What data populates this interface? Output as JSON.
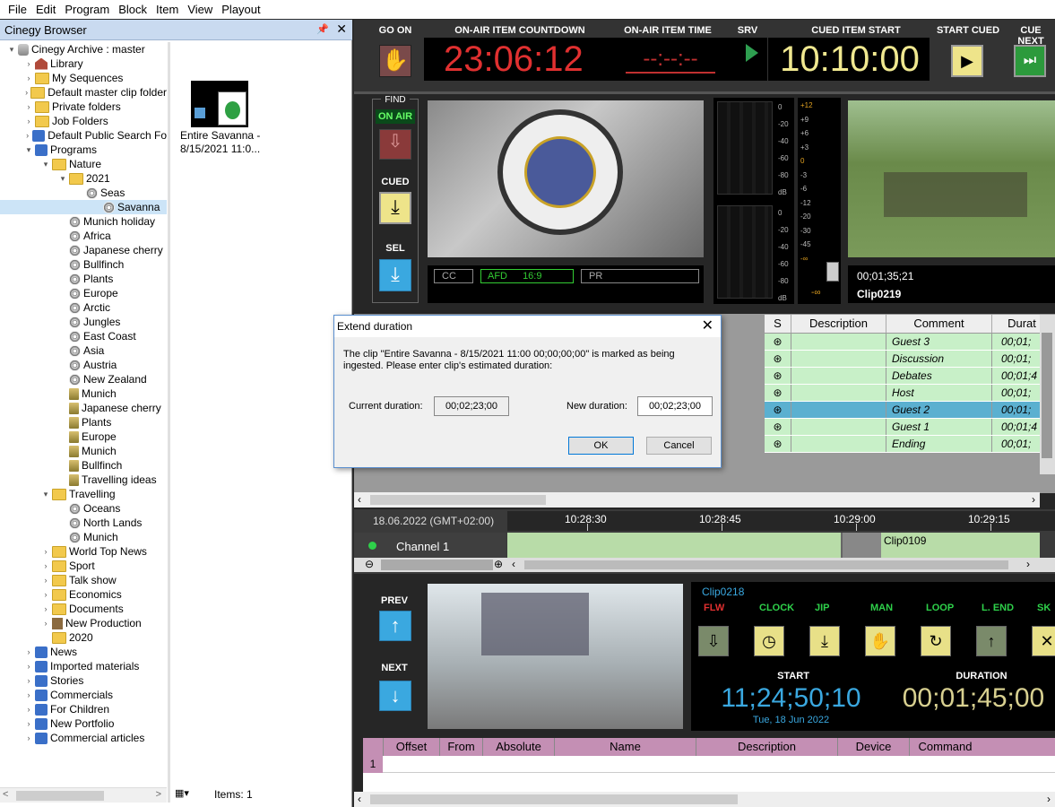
{
  "menu": [
    "File",
    "Edit",
    "Program",
    "Block",
    "Item",
    "View",
    "Playout"
  ],
  "browser": {
    "title": "Cinegy Browser",
    "pin": "ₚ",
    "close": "✕",
    "tree": [
      {
        "label": "Cinegy Archive : master",
        "depth": 0,
        "icon": "db",
        "arrow": "▾"
      },
      {
        "label": "Library",
        "depth": 1,
        "icon": "lib",
        "arrow": "›"
      },
      {
        "label": "My Sequences",
        "depth": 1,
        "icon": "folder",
        "arrow": "›"
      },
      {
        "label": "Default master clip folder",
        "depth": 1,
        "icon": "folder",
        "arrow": "›"
      },
      {
        "label": "Private folders",
        "depth": 1,
        "icon": "folder",
        "arrow": "›"
      },
      {
        "label": "Job Folders",
        "depth": 1,
        "icon": "folder",
        "arrow": "›"
      },
      {
        "label": "Default Public Search Fo",
        "depth": 1,
        "icon": "prog",
        "arrow": "›"
      },
      {
        "label": "Programs",
        "depth": 1,
        "icon": "prog",
        "arrow": "▾"
      },
      {
        "label": "Nature",
        "depth": 2,
        "icon": "folder",
        "arrow": "▾"
      },
      {
        "label": "2021",
        "depth": 3,
        "icon": "folder",
        "arrow": "▾"
      },
      {
        "label": "Seas",
        "depth": 4,
        "icon": "reel",
        "arrow": ""
      },
      {
        "label": "Savanna",
        "depth": 5,
        "icon": "reel",
        "arrow": "",
        "selected": true
      },
      {
        "label": "Munich holiday",
        "depth": 3,
        "icon": "reel",
        "arrow": ""
      },
      {
        "label": "Africa",
        "depth": 3,
        "icon": "reel",
        "arrow": ""
      },
      {
        "label": "Japanese cherry",
        "depth": 3,
        "icon": "reel",
        "arrow": ""
      },
      {
        "label": "Bullfinch",
        "depth": 3,
        "icon": "reel",
        "arrow": ""
      },
      {
        "label": "Plants",
        "depth": 3,
        "icon": "reel",
        "arrow": ""
      },
      {
        "label": "Europe",
        "depth": 3,
        "icon": "reel",
        "arrow": ""
      },
      {
        "label": "Arctic",
        "depth": 3,
        "icon": "reel",
        "arrow": ""
      },
      {
        "label": "Jungles",
        "depth": 3,
        "icon": "reel",
        "arrow": ""
      },
      {
        "label": "East Coast",
        "depth": 3,
        "icon": "reel",
        "arrow": ""
      },
      {
        "label": "Asia",
        "depth": 3,
        "icon": "reel",
        "arrow": ""
      },
      {
        "label": "Austria",
        "depth": 3,
        "icon": "reel",
        "arrow": ""
      },
      {
        "label": "New Zealand",
        "depth": 3,
        "icon": "reel",
        "arrow": ""
      },
      {
        "label": "Munich",
        "depth": 3,
        "icon": "bin",
        "arrow": ""
      },
      {
        "label": "Japanese cherry",
        "depth": 3,
        "icon": "bin",
        "arrow": ""
      },
      {
        "label": "Plants",
        "depth": 3,
        "icon": "bin",
        "arrow": ""
      },
      {
        "label": "Europe",
        "depth": 3,
        "icon": "bin",
        "arrow": ""
      },
      {
        "label": "Munich",
        "depth": 3,
        "icon": "bin",
        "arrow": ""
      },
      {
        "label": "Bullfinch",
        "depth": 3,
        "icon": "bin",
        "arrow": ""
      },
      {
        "label": "Travelling ideas",
        "depth": 3,
        "icon": "bin",
        "arrow": ""
      },
      {
        "label": "Travelling",
        "depth": 2,
        "icon": "folder",
        "arrow": "▾"
      },
      {
        "label": "Oceans",
        "depth": 3,
        "icon": "reel",
        "arrow": ""
      },
      {
        "label": "North Lands",
        "depth": 3,
        "icon": "reel",
        "arrow": ""
      },
      {
        "label": "Munich",
        "depth": 3,
        "icon": "reel",
        "arrow": ""
      },
      {
        "label": "World Top News",
        "depth": 2,
        "icon": "folder",
        "arrow": "›"
      },
      {
        "label": "Sport",
        "depth": 2,
        "icon": "folder",
        "arrow": "›"
      },
      {
        "label": "Talk show",
        "depth": 2,
        "icon": "folder",
        "arrow": "›"
      },
      {
        "label": "Economics",
        "depth": 2,
        "icon": "folder",
        "arrow": "›"
      },
      {
        "label": "Documents",
        "depth": 2,
        "icon": "folder",
        "arrow": "›"
      },
      {
        "label": "New Production",
        "depth": 2,
        "icon": "np",
        "arrow": "›"
      },
      {
        "label": "2020",
        "depth": 2,
        "icon": "folder",
        "arrow": ""
      },
      {
        "label": "News",
        "depth": 1,
        "icon": "prog",
        "arrow": "›"
      },
      {
        "label": "Imported materials",
        "depth": 1,
        "icon": "prog",
        "arrow": "›"
      },
      {
        "label": "Stories",
        "depth": 1,
        "icon": "prog",
        "arrow": "›"
      },
      {
        "label": "Commercials",
        "depth": 1,
        "icon": "prog",
        "arrow": "›"
      },
      {
        "label": "For Children",
        "depth": 1,
        "icon": "prog",
        "arrow": "›"
      },
      {
        "label": "New Portfolio",
        "depth": 1,
        "icon": "prog",
        "arrow": "›"
      },
      {
        "label": "Commercial articles",
        "depth": 1,
        "icon": "prog",
        "arrow": "›"
      }
    ],
    "thumb_caption": "Entire Savanna - 8/15/2021 11:0...",
    "items_count": "Items: 1",
    "scroll_left": "<",
    "scroll_right": ">"
  },
  "top": {
    "go_on": "GO ON",
    "countdown_label": "ON-AIR ITEM COUNTDOWN",
    "countdown": "23:06:12",
    "item_time_label": "ON-AIR ITEM TIME",
    "item_time": "--:--:--",
    "srv_label": "SRV",
    "cued_start_label": "CUED ITEM START",
    "cued_start": "10:10:00",
    "start_cued": "START CUED",
    "cue_next": "CUE NEXT"
  },
  "mid": {
    "find": "FIND",
    "on_air": "ON AIR",
    "cued": "CUED",
    "sel": "SEL",
    "cc": "CC",
    "afd": "AFD",
    "afd_val": "16:9",
    "pr": "PR",
    "meter_scale": [
      "0",
      "-20",
      "-40",
      "-60",
      "-80",
      "dB",
      "0",
      "-20",
      "-40",
      "-60",
      "-80",
      "dB"
    ],
    "fader_scale": [
      "+12",
      "+9",
      "+6",
      "+3",
      "0",
      "-3",
      "-6",
      "-12",
      "-20",
      "-30",
      "-45",
      "-∞"
    ],
    "fader_min": "-∞",
    "preview_tc": "00;01;35;21",
    "preview_clip": "Clip0219"
  },
  "grid": {
    "headers": [
      "S",
      "Description",
      "Comment",
      "Durat"
    ],
    "rows": [
      {
        "comment": "Guest 3",
        "dur": "00;01;"
      },
      {
        "comment": "Discussion",
        "dur": "00;01;"
      },
      {
        "comment": "Debates",
        "dur": "00;01;4"
      },
      {
        "comment": "Host",
        "dur": "00;01;"
      },
      {
        "comment": "Guest 2",
        "dur": "00;01;",
        "selected": true
      },
      {
        "comment": "Guest 1",
        "dur": "00;01;4"
      },
      {
        "comment": "Ending",
        "dur": "00;01;"
      }
    ]
  },
  "timeline": {
    "date": "18.06.2022 (GMT+02:00)",
    "ticks": [
      "10:28:30",
      "10:28:45",
      "10:29:00",
      "10:29:15"
    ],
    "channel": "Channel 1",
    "clip": "Clip0109"
  },
  "bottom": {
    "prev": "PREV",
    "next": "NEXT",
    "clip": "Clip0218",
    "modes": [
      "FLW",
      "CLOCK",
      "JIP",
      "MAN",
      "LOOP",
      "L. END",
      "SK"
    ],
    "start_label": "START",
    "start": "11;24;50;10",
    "start_date": "Tue, 18 Jun 2022",
    "duration_label": "DURATION",
    "duration": "00;01;45;00"
  },
  "events": {
    "headers": [
      "Offset",
      "From",
      "Absolute",
      "Name",
      "Description",
      "Device",
      "Command"
    ],
    "row_num": "1"
  },
  "dialog": {
    "title": "Extend duration",
    "message": "The clip \"Entire Savanna - 8/15/2021 11:00 00;00;00;00\" is marked as being ingested. Please enter clip's estimated duration:",
    "current_label": "Current duration:",
    "current": "00;02;23;00",
    "new_label": "New duration:",
    "new": "00;02;23;00",
    "ok": "OK",
    "cancel": "Cancel"
  },
  "colors": {
    "accent": "#3aa8e0",
    "countdown": "#e03030",
    "cued": "#f0e890",
    "green": "#c8f0c8",
    "sel_row": "#5bb0d0"
  }
}
